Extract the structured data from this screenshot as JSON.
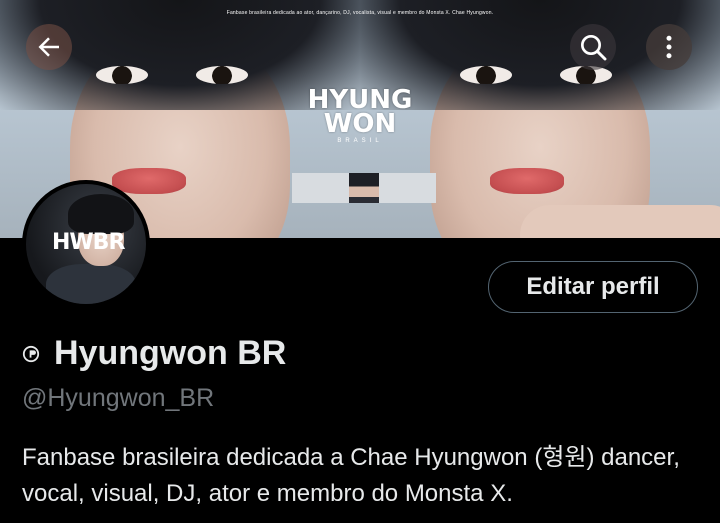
{
  "banner": {
    "top_caption": "Fanbase brasileira dedicada ao ator, dançarino, DJ, vocalista, visual e membro do Monsta X. Chae Hyungwon.",
    "logo_line1": "HYUNG",
    "logo_line2": "WON",
    "logo_sub": "BRASIL"
  },
  "nav": {
    "back_icon": "arrow-left-icon",
    "search_icon": "search-icon",
    "more_icon": "more-vertical-icon"
  },
  "avatar": {
    "logo": "HWBR"
  },
  "profile": {
    "edit_label": "Editar perfil",
    "display_name": "Hyungwon BR",
    "handle": "@Hyungwon_BR",
    "bio": "Fanbase brasileira dedicada a Chae Hyungwon (형원) dancer, vocal, visual, DJ, ator e membro do Monsta X."
  },
  "colors": {
    "background": "#000000",
    "text_primary": "#e7e9ea",
    "text_secondary": "#71767b",
    "button_border": "#536471"
  }
}
